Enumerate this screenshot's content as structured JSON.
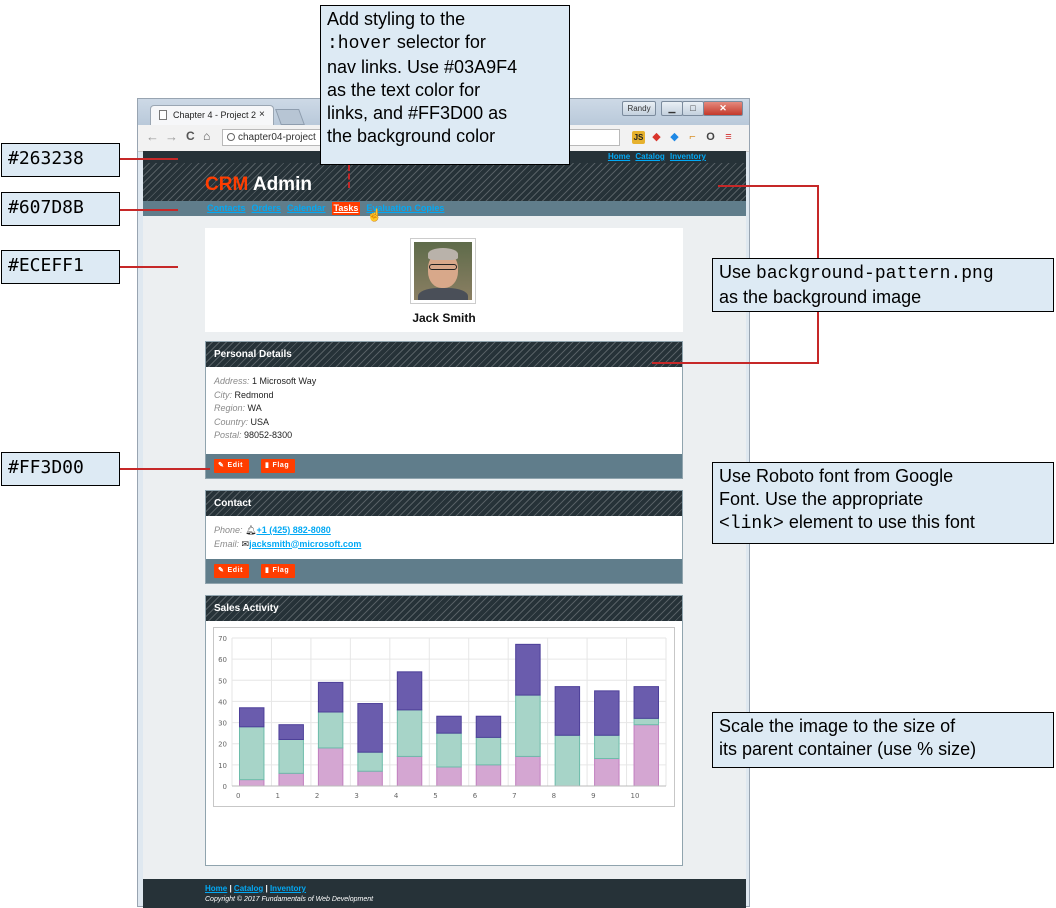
{
  "browser": {
    "tab_title": "Chapter 4 - Project 2",
    "tab_close": "×",
    "address": "chapter04-project",
    "user_badge": "Randy",
    "back_glyph": "←",
    "forward_glyph": "→",
    "reload_glyph": "C",
    "home_glyph": "♠"
  },
  "site": {
    "top_links": [
      "Home",
      "Catalog",
      "Inventory"
    ],
    "brand_accent": "CRM",
    "brand_text": " Admin",
    "nav_links": [
      "Contacts",
      "Orders",
      "Calendar",
      "Tasks",
      "Evaluation Copies"
    ],
    "profile_name": "Jack Smith",
    "personal": {
      "title": "Personal Details",
      "rows": [
        {
          "label": "Address:",
          "value": "1 Microsoft Way"
        },
        {
          "label": "City:",
          "value": "Redmond"
        },
        {
          "label": "Region:",
          "value": "WA"
        },
        {
          "label": "Country:",
          "value": "USA"
        },
        {
          "label": "Postal:",
          "value": "98052-8300"
        }
      ]
    },
    "buttons": {
      "edit": "Edit",
      "flag": "Flag"
    },
    "contact": {
      "title": "Contact",
      "phone_label": "Phone:",
      "phone": "+1 (425) 882-8080",
      "email_label": "Email:",
      "email": "jacksmith@microsoft.com"
    },
    "sales_title": "Sales Activity",
    "footer_links": [
      "Home",
      "Catalog",
      "Inventory"
    ],
    "footer_sep": " | ",
    "copyright": "Copyright © 2017 Fundamentals of Web Development"
  },
  "annotations": {
    "color_263238": "#263238",
    "color_607d8b": "#607D8B",
    "color_eceff1": "#ECEFF1",
    "color_ff3d00": "#FF3D00",
    "hover_note": [
      {
        "text": "Add styling to the"
      },
      {
        "mono": ":hover",
        "text": " selector for"
      },
      {
        "text": "nav links. Use #03A9F4"
      },
      {
        "text": "as the text color for"
      },
      {
        "text": "links, and #FF3D00 as"
      },
      {
        "text": "the background color"
      }
    ],
    "bg_note_mono": "background-pattern.png",
    "bg_note_line1_suffix": "Use ",
    "bg_note_line2": "as the background image",
    "font_note_line1": "Use Roboto font from Google",
    "font_note_line2": "Font. Use the appropriate",
    "font_note_mono": "<link>",
    "font_note_line3_suffix": " element to use this font",
    "scale_note_line1": "Scale the image to the size of",
    "scale_note_line2": "its parent container (use % size)"
  },
  "colors": {
    "dark": "#263238",
    "slate": "#607D8B",
    "bg": "#ECEFF1",
    "accent": "#FF3D00",
    "link": "#03A9F4",
    "series_bottom": "#d4a6d2",
    "series_middle": "#a7d4c8",
    "series_top": "#6a5cad"
  },
  "chart_data": {
    "type": "bar",
    "stacked": true,
    "title": "Sales Activity",
    "categories": [
      "0",
      "1",
      "2",
      "3",
      "4",
      "5",
      "6",
      "7",
      "8",
      "9",
      "10"
    ],
    "series": [
      {
        "values": [
          3,
          6,
          18,
          7,
          14,
          9,
          10,
          14,
          0,
          13,
          29
        ]
      },
      {
        "values": [
          25,
          16,
          17,
          9,
          22,
          16,
          13,
          29,
          24,
          11,
          3
        ]
      },
      {
        "values": [
          9,
          7,
          14,
          23,
          18,
          8,
          10,
          24,
          23,
          21,
          15
        ]
      }
    ],
    "ylim": [
      0,
      70
    ],
    "yticks": [
      0,
      10,
      20,
      30,
      40,
      50,
      60,
      70
    ],
    "grid": true,
    "legend": "none"
  }
}
